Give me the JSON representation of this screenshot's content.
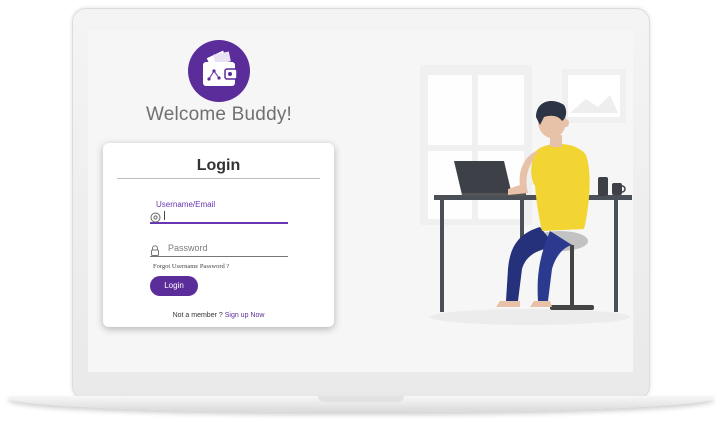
{
  "app": {
    "welcome_text": "Welcome Buddy!"
  },
  "login_card": {
    "title": "Login",
    "username": {
      "label": "Username/Email",
      "value": ""
    },
    "password": {
      "placeholder": "Password",
      "value": ""
    },
    "forgot_link": "Forgot Username Password ?",
    "login_button": "Login",
    "signup_prompt": "Not a member ?",
    "signup_link": "Sign up Now"
  },
  "colors": {
    "brand": "#5b2d9a",
    "accent": "#6a35b0"
  },
  "icons": {
    "logo": "wallet-icon",
    "username": "at-sign-icon",
    "password": "lock-icon"
  }
}
